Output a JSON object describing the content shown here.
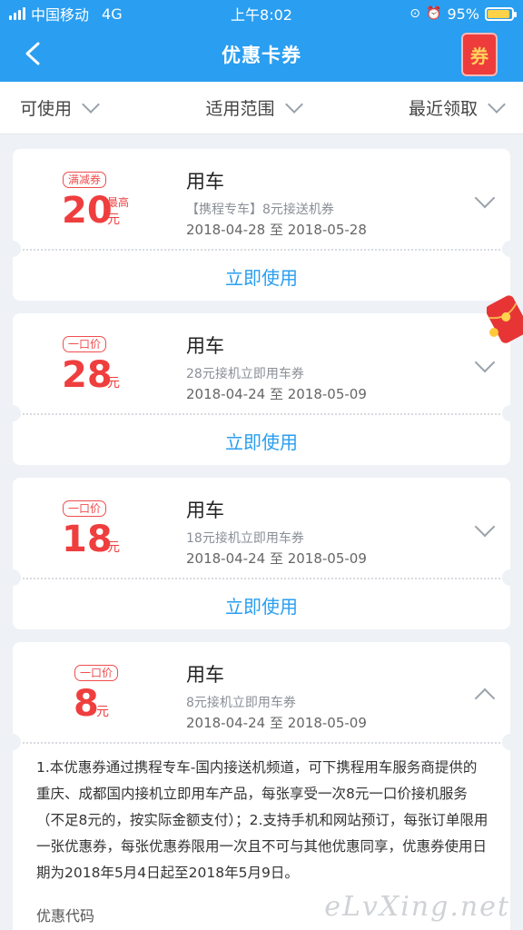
{
  "status_bar": {
    "carrier": "中国移动",
    "network": "4G",
    "time": "上午8:02",
    "battery": "95%"
  },
  "header": {
    "title": "优惠卡券",
    "coupon_icon_text": "券"
  },
  "filters": [
    {
      "label": "可使用"
    },
    {
      "label": "适用范围"
    },
    {
      "label": "最近领取"
    }
  ],
  "coupons": [
    {
      "tag": "满减券",
      "amount": "20",
      "unit": "元",
      "max_label": "最高",
      "title": "用车",
      "desc": "【携程专车】8元接送机券",
      "date": "2018-04-28 至 2018-05-28",
      "action": "立即使用"
    },
    {
      "tag": "一口价",
      "amount": "28",
      "unit": "元",
      "title": "用车",
      "desc": "28元接机立即用车券",
      "date": "2018-04-24 至 2018-05-09",
      "action": "立即使用"
    },
    {
      "tag": "一口价",
      "amount": "18",
      "unit": "元",
      "title": "用车",
      "desc": "18元接机立即用车券",
      "date": "2018-04-24 至 2018-05-09",
      "action": "立即使用"
    },
    {
      "tag": "一口价",
      "amount": "8",
      "unit": "元",
      "title": "用车",
      "desc": "8元接机立即用车券",
      "date": "2018-04-24 至 2018-05-09",
      "detail": "1.本优惠券通过携程专车-国内接送机频道，可下携程用车服务商提供的重庆、成都国内接机立即用车产品，每张享受一次8元一口价接机服务（不足8元的，按实际金额支付）；2.支持手机和网站预订，每张订单限用一张优惠券，每张优惠券限用一次且不可与其他优惠同享，优惠券使用日期为2018年5月4日起至2018年5月9日。",
      "code_label": "优惠代码"
    }
  ],
  "watermark": "eLvXing.net",
  "colors": {
    "brand_blue": "#2a9ef0",
    "coupon_red": "#ef3e3e",
    "background": "#eef1f5"
  }
}
